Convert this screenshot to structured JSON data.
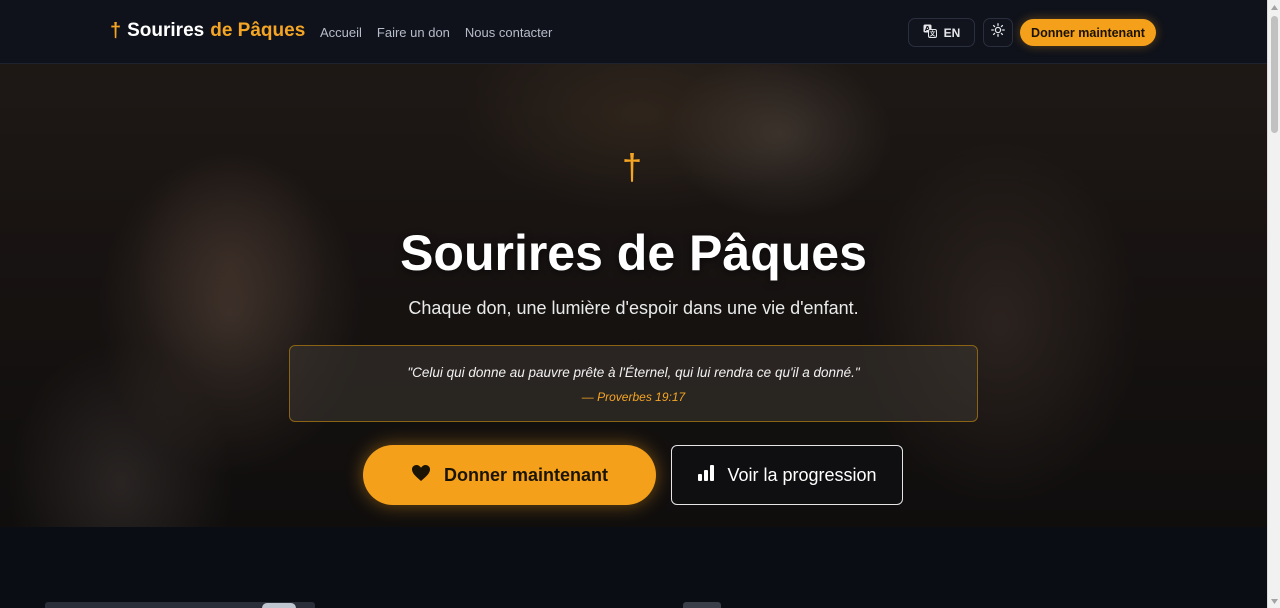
{
  "navbar": {
    "brand_cross": "†",
    "brand_part1": "Sourires",
    "brand_part2": "de Pâques",
    "links": [
      "Accueil",
      "Faire un don",
      "Nous contacter"
    ],
    "lang_label": "EN",
    "lang_icon": "translate-icon",
    "theme_icon": "sun-icon",
    "donate_label": "Donner maintenant"
  },
  "hero": {
    "cross": "†",
    "title": "Sourires de Pâques",
    "subtitle": "Chaque don, une lumière d'espoir dans une vie d'enfant.",
    "quote": "\"Celui qui donne au pauvre prête à l'Éternel, qui lui rendra ce qu'il a donné.\"",
    "quote_ref": "— Proverbes 19:17",
    "donate_label": "Donner maintenant",
    "donate_icon": "heart-icon",
    "progress_label": "Voir la progression",
    "progress_icon": "bar-chart-icon"
  },
  "colors": {
    "accent": "#f5a01a",
    "background": "#0b0d14",
    "navbar": "#0f121b"
  }
}
